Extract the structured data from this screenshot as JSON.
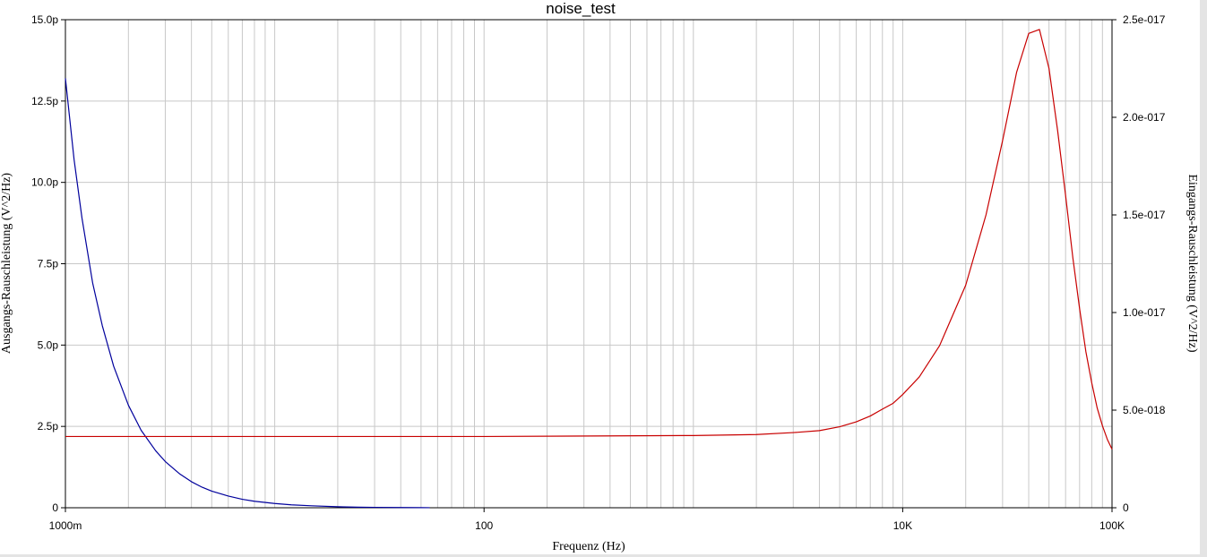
{
  "chart_data": {
    "type": "line",
    "title": "noise_test",
    "xlabel": "Frequenz (Hz)",
    "ylabel_left": "Ausgangs-Rauschleistung (V^2/Hz)",
    "ylabel_right": "Eingangs-Rauschleistung (V^2/Hz)",
    "x_scale": "log",
    "xlim": [
      1,
      100000
    ],
    "ylim_left": [
      0,
      1.5e-11
    ],
    "ylim_right": [
      0,
      2.5e-17
    ],
    "x_ticks": [
      {
        "value": 1,
        "label": "1000m"
      },
      {
        "value": 100,
        "label": "100"
      },
      {
        "value": 10000,
        "label": "10K"
      },
      {
        "value": 100000,
        "label": "100K"
      }
    ],
    "y_ticks_left": [
      {
        "value": 0,
        "label": "0"
      },
      {
        "value": 2.5e-12,
        "label": "2.5p"
      },
      {
        "value": 5e-12,
        "label": "5.0p"
      },
      {
        "value": 7.5e-12,
        "label": "7.5p"
      },
      {
        "value": 1e-11,
        "label": "10.0p"
      },
      {
        "value": 1.25e-11,
        "label": "12.5p"
      },
      {
        "value": 1.5e-11,
        "label": "15.0p"
      }
    ],
    "y_ticks_right": [
      {
        "value": 0,
        "label": "0"
      },
      {
        "value": 5e-18,
        "label": "5.0e-018"
      },
      {
        "value": 1e-17,
        "label": "1.0e-017"
      },
      {
        "value": 1.5e-17,
        "label": "1.5e-017"
      },
      {
        "value": 2e-17,
        "label": "2.0e-017"
      },
      {
        "value": 2.5e-17,
        "label": "2.5e-017"
      }
    ],
    "grid": true,
    "series": [
      {
        "axis": "left",
        "color": "#00009c",
        "x": [
          1,
          1.1,
          1.2,
          1.35,
          1.5,
          1.7,
          2,
          2.3,
          2.7,
          3,
          3.5,
          4,
          4.5,
          5,
          6,
          7,
          8,
          10,
          12,
          15,
          20,
          25,
          30,
          40,
          50,
          55
        ],
        "y": [
          1.32e-11,
          1.07e-11,
          8.9e-12,
          6.9e-12,
          5.6e-12,
          4.35e-12,
          3.15e-12,
          2.38e-12,
          1.75e-12,
          1.42e-12,
          1.05e-12,
          8e-13,
          6.3e-13,
          5.1e-13,
          3.6e-13,
          2.6e-13,
          2e-13,
          1.3e-13,
          9e-14,
          6e-14,
          3e-14,
          1.8e-14,
          1.2e-14,
          6e-15,
          3e-15,
          2e-15
        ]
      },
      {
        "axis": "right",
        "color": "#c80000",
        "x": [
          1,
          10,
          100,
          1000,
          2000,
          3000,
          4000,
          5000,
          6000,
          7000,
          8000,
          9000,
          10000,
          12000,
          15000,
          20000,
          25000,
          30000,
          35000,
          40000,
          45000,
          50000,
          55000,
          60000,
          65000,
          70000,
          75000,
          80000,
          85000,
          90000,
          95000,
          100000
        ],
        "y": [
          3.65e-18,
          3.65e-18,
          3.65e-18,
          3.7e-18,
          3.75e-18,
          3.85e-18,
          3.95e-18,
          4.15e-18,
          4.4e-18,
          4.7e-18,
          5.05e-18,
          5.35e-18,
          5.8e-18,
          6.7e-18,
          8.3e-18,
          1.14e-17,
          1.5e-17,
          1.88e-17,
          2.23e-17,
          2.43e-17,
          2.45e-17,
          2.25e-17,
          1.93e-17,
          1.6e-17,
          1.28e-17,
          1.02e-17,
          8e-18,
          6.4e-18,
          5.1e-18,
          4.2e-18,
          3.5e-18,
          3e-18
        ]
      }
    ]
  }
}
